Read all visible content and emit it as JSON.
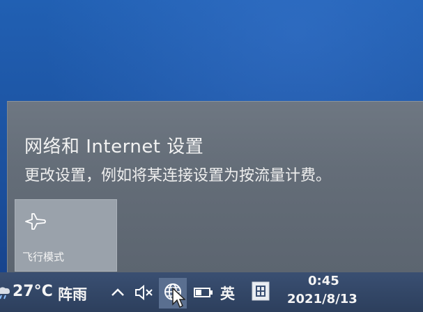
{
  "flyout": {
    "title": "网络和 Internet 设置",
    "description": "更改设置，例如将某连接设置为按流量计费。",
    "quick_actions": [
      {
        "label": "飞行模式",
        "icon": "airplane-icon"
      }
    ]
  },
  "taskbar": {
    "weather": {
      "temperature": "27°C",
      "condition": "阵雨"
    },
    "ime_language": "英",
    "clock": {
      "time": "0:45",
      "date": "2021/8/13"
    }
  }
}
